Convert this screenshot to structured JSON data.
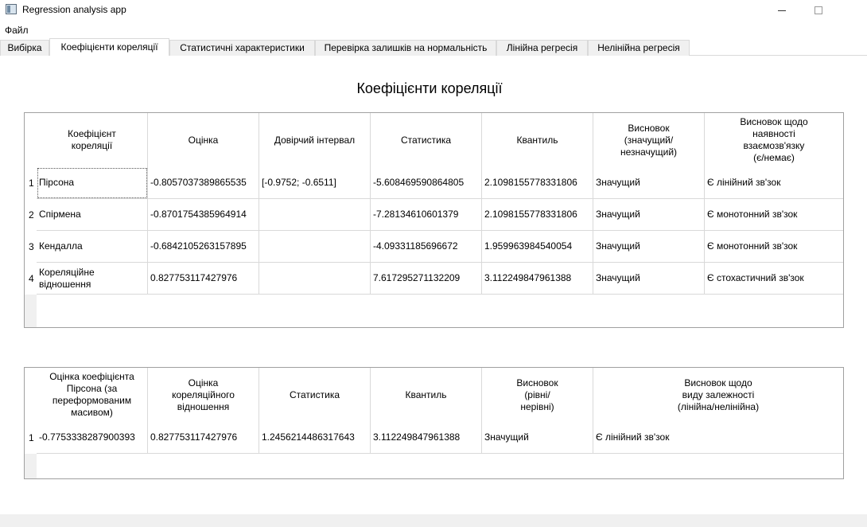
{
  "window": {
    "title": "Regression analysis app"
  },
  "menu": {
    "file": "Файл"
  },
  "tabs": [
    {
      "label": "Вибірка"
    },
    {
      "label": "Коефіцієнти кореляції",
      "active": true
    },
    {
      "label": "Статистичні характеристики"
    },
    {
      "label": "Перевірка залишків на нормальність"
    },
    {
      "label": "Лінійна регресія"
    },
    {
      "label": "Нелінійна регресія"
    }
  ],
  "page": {
    "heading": "Коефіцієнти кореляції"
  },
  "table1": {
    "headers": [
      "Коефіцієнт\nкореляції",
      "Оцінка",
      "Довірчий інтервал",
      "Статистика",
      "Квантиль",
      "Висновок\n(значущий/\nнезначущий)",
      "Висновок щодо\nнаявності\nвзаємозв'язку\n(є/немає)"
    ],
    "row_numbers": [
      "1",
      "2",
      "3",
      "4"
    ],
    "rows": [
      [
        "Пірсона",
        "-0.8057037389865535",
        "[-0.9752; -0.6511]",
        "-5.608469590864805",
        "2.1098155778331806",
        "Значущий",
        "Є лінійний зв'зок"
      ],
      [
        "Спірмена",
        "-0.8701754385964914",
        "",
        "-7.28134610601379",
        "2.1098155778331806",
        "Значущий",
        "Є монотонний зв'зок"
      ],
      [
        "Кендалла",
        "-0.6842105263157895",
        "",
        "-4.09331185696672",
        "1.959963984540054",
        "Значущий",
        "Є монотонний зв'зок"
      ],
      [
        "Кореляційне\nвідношення",
        "0.827753117427976",
        "",
        "7.617295271132209",
        "3.112249847961388",
        "Значущий",
        "Є стохастичний зв'зок"
      ]
    ]
  },
  "table2": {
    "headers": [
      "Оцінка коефіцієнта\nПірсона (за\nпереформованим\nмасивом)",
      "Оцінка\nкореляційного\nвідношення",
      "Статистика",
      "Квантиль",
      "Висновок\n(рівні/\nнерівні)",
      "Висновок щодо\nвиду залежності\n(лінійна/нелінійна)"
    ],
    "row_numbers": [
      "1"
    ],
    "rows": [
      [
        "-0.7753338287900393",
        "0.827753117427976",
        "1.2456214486317643",
        "3.112249847961388",
        "Значущий",
        "Є лінійний зв'зок"
      ]
    ]
  }
}
